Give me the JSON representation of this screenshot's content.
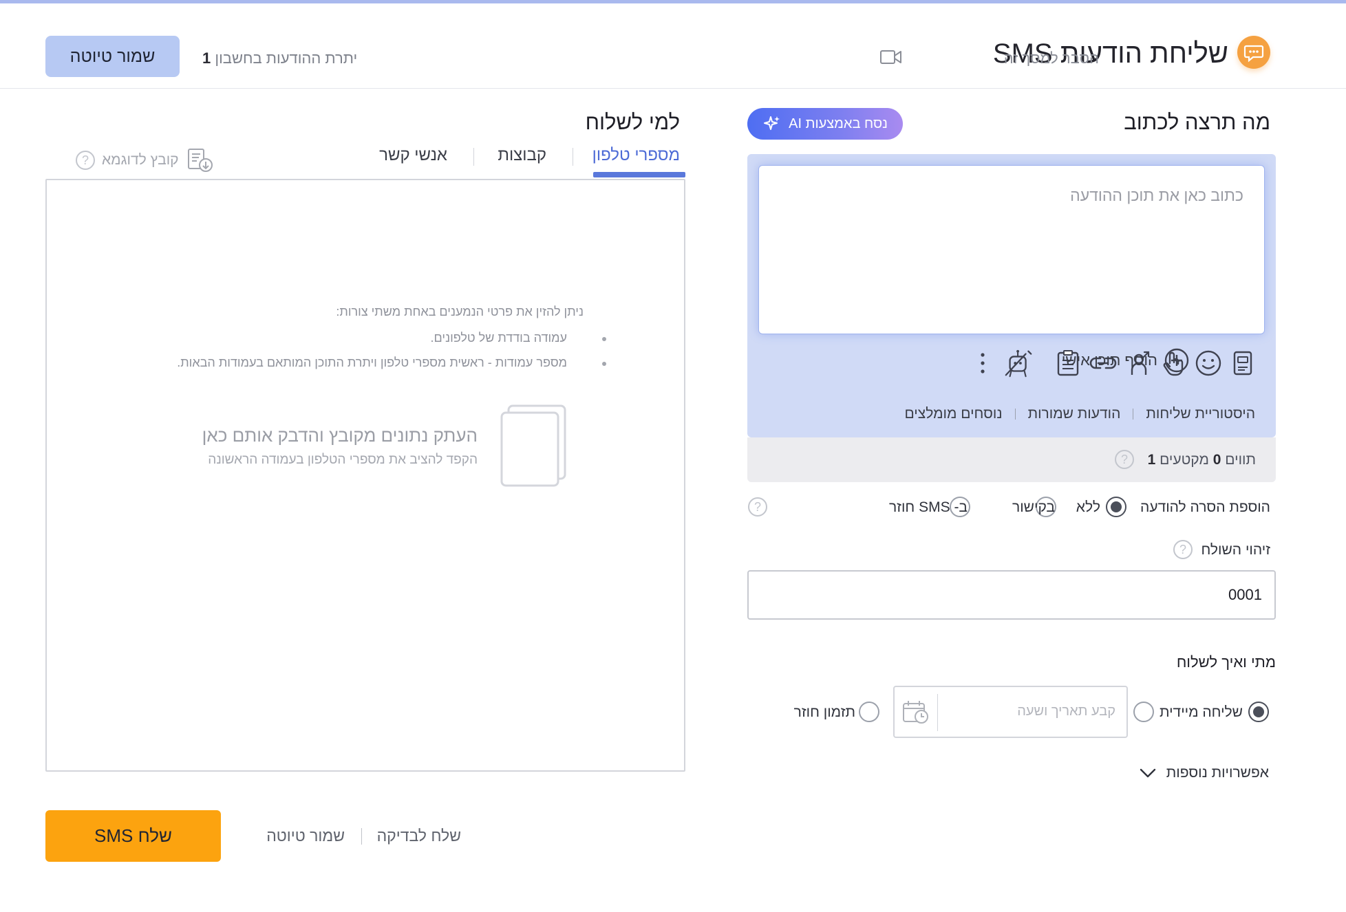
{
  "header": {
    "title": "שליחת הודעות SMS",
    "explain_label": "הסבר למסך זה",
    "save_draft": "שמור טיוטה",
    "remaining_label": "יתרת ההודעות בחשבון",
    "remaining_count": "1"
  },
  "compose": {
    "title": "מה תרצה לכתוב",
    "ai_button": "נסח באמצעות AI",
    "message_placeholder": "כתוב כאן את תוכן ההודעה",
    "toolbar_icons": [
      "contact-card-icon",
      "emoji-icon",
      "touch-icon",
      "share-person-icon",
      "link-icon",
      "list-icon",
      "ai-robot-icon",
      "more-vertical-icon"
    ],
    "add_content": "הוסף תוכן אישי",
    "links": [
      "היסטוריית שליחות",
      "הודעות שמורות",
      "נוסחים מומלצים"
    ],
    "counter_prefix": "תווים",
    "counter_chars": "0",
    "counter_middle": "מקטעים",
    "counter_segments": "1"
  },
  "removal": {
    "label": "הוספת הסרה להודעה",
    "options": [
      "ללא",
      "בקישור",
      "ב- SMS חוזר"
    ],
    "selected": "ללא"
  },
  "sender": {
    "label": "זיהוי השולח",
    "value": "0001"
  },
  "timing": {
    "title": "מתי ואיך לשלוח",
    "immediate": "שליחה מיידית",
    "date_placeholder": "קבע תאריך ושעה",
    "recurring": "תזמון חוזר",
    "selected": "שליחה מיידית",
    "more_options": "אפשרויות נוספות"
  },
  "recipients": {
    "title": "למי לשלוח",
    "tabs": [
      "מספרי טלפון",
      "קבוצות",
      "אנשי קשר"
    ],
    "active_tab": "מספרי טלפון",
    "sample_file": "קובץ לדוגמא",
    "instructions_title": "ניתן להזין את פרטי הנמענים באחת משתי צורות:",
    "instructions": [
      "עמודה בודדת של טלפונים.",
      "מספר עמודות - ראשית מספרי טלפון ויתרת התוכן המותאם בעמודות הבאות."
    ],
    "paste_title": "העתק נתונים מקובץ והדבק אותם כאן",
    "paste_subtitle": "הקפד להציב את מספרי הטלפון בעמודה הראשונה"
  },
  "footer": {
    "send": "שלח SMS",
    "save_draft": "שמור טיוטה",
    "send_test": "שלח לבדיקה"
  },
  "colors": {
    "accent": "#5a78db",
    "send_button": "#fca30f",
    "draft_button": "#b7c9f3",
    "logo": "#f5a141"
  }
}
